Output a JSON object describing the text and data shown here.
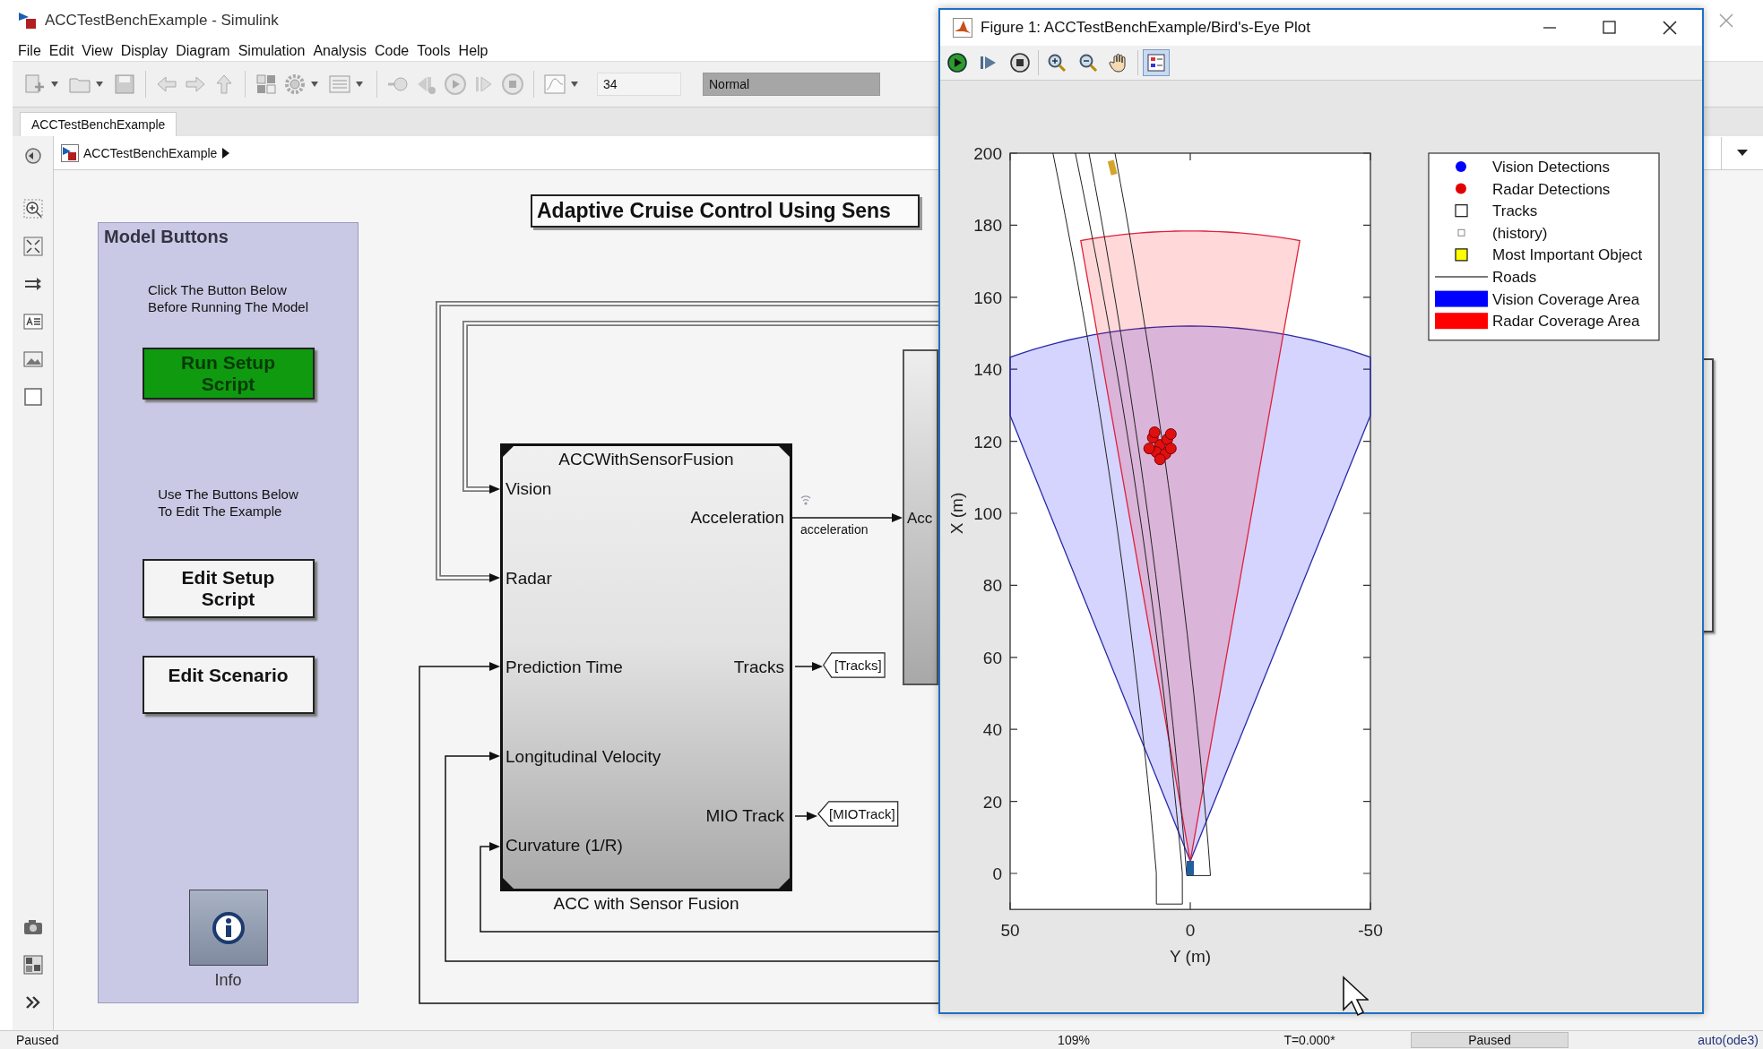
{
  "window": {
    "title": "ACCTestBenchExample - Simulink"
  },
  "menu": [
    {
      "label": "File"
    },
    {
      "label": "Edit"
    },
    {
      "label": "View"
    },
    {
      "label": "Display"
    },
    {
      "label": "Diagram"
    },
    {
      "label": "Simulation"
    },
    {
      "label": "Analysis"
    },
    {
      "label": "Code"
    },
    {
      "label": "Tools"
    },
    {
      "label": "Help"
    }
  ],
  "toolbar": {
    "stop_time": "34",
    "mode": "Normal"
  },
  "tabs": [
    {
      "label": "ACCTestBenchExample",
      "selected": true
    }
  ],
  "breadcrumb": {
    "label": "ACCTestBenchExample"
  },
  "canvas": {
    "title": "Adaptive Cruise Control Using Sens",
    "model_buttons": {
      "heading": "Model Buttons",
      "items": [
        {
          "kind": "note",
          "text": "Click The Button Below\nBefore Running The Model"
        },
        {
          "kind": "button",
          "label": "Run Setup Script",
          "color": "#0f9a10"
        },
        {
          "kind": "note",
          "text": "Use The Buttons Below\nTo Edit The Example"
        },
        {
          "kind": "button",
          "label": "Edit Setup Script",
          "color": "#f4f4f4"
        },
        {
          "kind": "button",
          "label": "Edit Scenario",
          "color": "#f4f4f4"
        },
        {
          "kind": "info",
          "label": "Info"
        }
      ]
    },
    "block": {
      "name": "ACCWithSensorFusion",
      "caption": "ACC with Sensor Fusion",
      "inputs": [
        {
          "label": "Vision"
        },
        {
          "label": "Radar"
        },
        {
          "label": "Prediction Time"
        },
        {
          "label": "Longitudinal Velocity"
        },
        {
          "label": "Curvature (1/R)"
        }
      ],
      "outputs": [
        {
          "label": "Acceleration"
        },
        {
          "label": "Tracks"
        },
        {
          "label": "MIO Track"
        }
      ]
    },
    "signal_label": "acceleration",
    "goto_tags": [
      "[Tracks]",
      "[MIOTrack]"
    ],
    "next_block_port": "Acc"
  },
  "figure": {
    "title": "Figure 1: ACCTestBenchExample/Bird's-Eye Plot",
    "toolbar": [
      {
        "kind": "run",
        "selected": false
      },
      {
        "kind": "step",
        "selected": false
      },
      {
        "kind": "stop",
        "selected": false
      },
      {
        "kind": "zoom_in",
        "selected": false
      },
      {
        "kind": "zoom_out",
        "selected": false
      },
      {
        "kind": "pan",
        "selected": false
      },
      {
        "kind": "legend",
        "selected": true
      }
    ],
    "plot": {
      "x_label": "Y (m)",
      "y_label": "X (m)",
      "x_tick_labels": [
        "50",
        "0",
        "-50"
      ],
      "y_tick_labels": [
        "200",
        "180",
        "160",
        "140",
        "120",
        "100",
        "80",
        "60",
        "40",
        "20",
        "0"
      ],
      "legend": [
        {
          "kind": "dot",
          "label": "Vision Detections",
          "color": "#0000ff"
        },
        {
          "kind": "dot",
          "label": "Radar Detections",
          "color": "#e00000"
        },
        {
          "kind": "square",
          "label": "Tracks"
        },
        {
          "kind": "small_square",
          "label": "(history)"
        },
        {
          "kind": "filled_square",
          "label": "Most Important Object",
          "color": "#ffff00"
        },
        {
          "kind": "line",
          "label": "Roads"
        },
        {
          "kind": "patch",
          "label": "Vision Coverage Area",
          "color": "#0000ff"
        },
        {
          "kind": "patch",
          "label": "Radar Coverage Area",
          "color": "#ff0000"
        }
      ]
    }
  },
  "status_bar": {
    "left": "Paused",
    "zoom": "109%",
    "time": "T=0.000*",
    "state": "Paused",
    "solver": "auto(ode3)"
  }
}
